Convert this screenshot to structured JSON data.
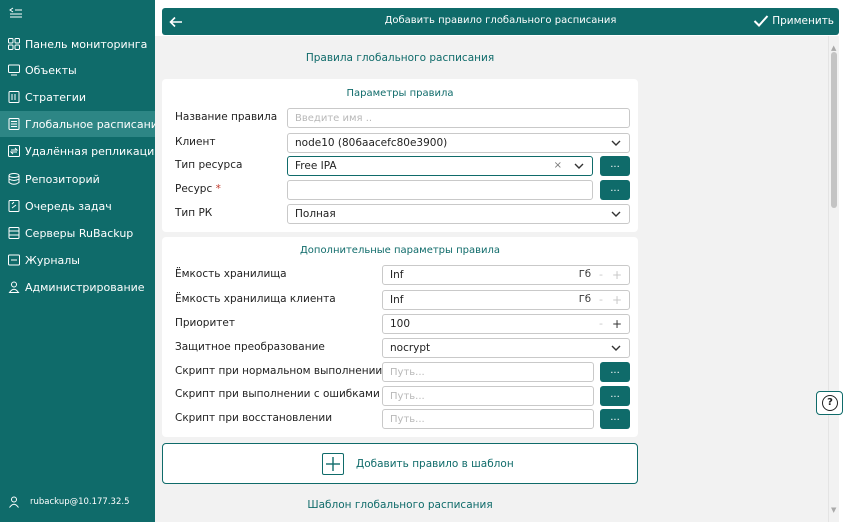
{
  "sidebar": {
    "items": [
      {
        "label": "Панель мониторинга"
      },
      {
        "label": "Объекты"
      },
      {
        "label": "Стратегии"
      },
      {
        "label": "Глобальное расписание"
      },
      {
        "label": "Удалённая репликация"
      },
      {
        "label": "Репозиторий"
      },
      {
        "label": "Очередь задач"
      },
      {
        "label": "Серверы RuBackup"
      },
      {
        "label": "Журналы"
      },
      {
        "label": "Администрирование"
      }
    ],
    "active_index": 3,
    "user": "rubackup@10.177.32.5"
  },
  "header": {
    "title": "Добавить правило глобального расписания",
    "apply_label": "Применить"
  },
  "main": {
    "section_title": "Правила глобального расписания",
    "rule_params": {
      "title": "Параметры правила",
      "name_label": "Название правила",
      "name_placeholder": "Введите имя ..",
      "client_label": "Клиент",
      "client_value": "node10 (806aacefc80e3900)",
      "resource_type_label": "Тип ресурса",
      "resource_type_value": "Free IPA",
      "resource_label": "Ресурс",
      "required_mark": "*",
      "backup_type_label": "Тип РК",
      "backup_type_value": "Полная",
      "dots": "..."
    },
    "extra_params": {
      "title": "Дополнительные параметры правила",
      "storage_label": "Ёмкость хранилища",
      "storage_value": "Inf",
      "client_storage_label": "Ёмкость хранилища клиента",
      "client_storage_value": "Inf",
      "unit": "Гб",
      "priority_label": "Приоритет",
      "priority_value": "100",
      "protect_label": "Защитное преобразование",
      "protect_value": "nocrypt",
      "script_ok_label": "Скрипт при нормальном выполнении",
      "script_err_label": "Скрипт при выполнении с ошибками",
      "script_restore_label": "Скрипт при восстановлении",
      "path_placeholder": "Путь...",
      "dots": "..."
    },
    "add_to_template": "Добавить правило в шаблон",
    "template_title": "Шаблон глобального расписания"
  },
  "colors": {
    "accent": "#0f6b6a",
    "sidebar_active": "#2d8685",
    "required": "#c0392b"
  }
}
